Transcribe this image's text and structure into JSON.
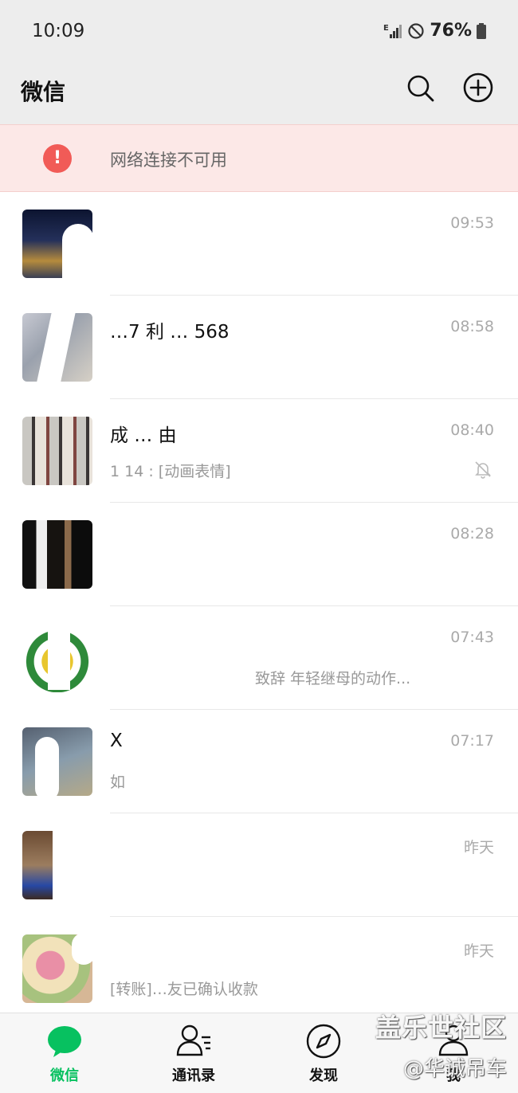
{
  "status_bar": {
    "time": "10:09",
    "network": "E",
    "battery": "76%"
  },
  "header": {
    "title": "微信",
    "search_icon": "search-icon",
    "add_icon": "plus-circle-icon"
  },
  "banner": {
    "icon": "exclamation-icon",
    "text": "网络连接不可用",
    "colors": {
      "bg": "#fce8e7",
      "icon": "#f15b57"
    }
  },
  "chats": [
    {
      "name": "",
      "preview": "",
      "time": "09:53",
      "muted": false
    },
    {
      "name": "…7 利 … 568",
      "preview": "",
      "time": "08:58",
      "muted": false
    },
    {
      "name": "成 … 由",
      "preview": "1  14 : [动画表情]",
      "time": "08:40",
      "muted": true
    },
    {
      "name": "",
      "preview": "",
      "time": "08:28",
      "muted": false
    },
    {
      "name": "",
      "preview": "致辞 年轻继母的动作...",
      "time": "07:43",
      "muted": false
    },
    {
      "name": "X",
      "preview": "如",
      "time": "07:17",
      "muted": false
    },
    {
      "name": "",
      "preview": "",
      "time": "昨天",
      "muted": false
    },
    {
      "name": "",
      "preview": "[转账]…友已确认收款",
      "time": "昨天",
      "muted": false
    }
  ],
  "tabs": [
    {
      "label": "微信",
      "icon": "chat-bubble-icon",
      "active": true
    },
    {
      "label": "通讯录",
      "icon": "contacts-icon",
      "active": false
    },
    {
      "label": "发现",
      "icon": "compass-icon",
      "active": false
    },
    {
      "label": "我",
      "icon": "person-icon",
      "active": false
    }
  ],
  "watermark": {
    "line1": "盖乐世社区",
    "line2": "@华诚吊车"
  },
  "colors": {
    "accent": "#07c160",
    "header_bg": "#ededed"
  }
}
